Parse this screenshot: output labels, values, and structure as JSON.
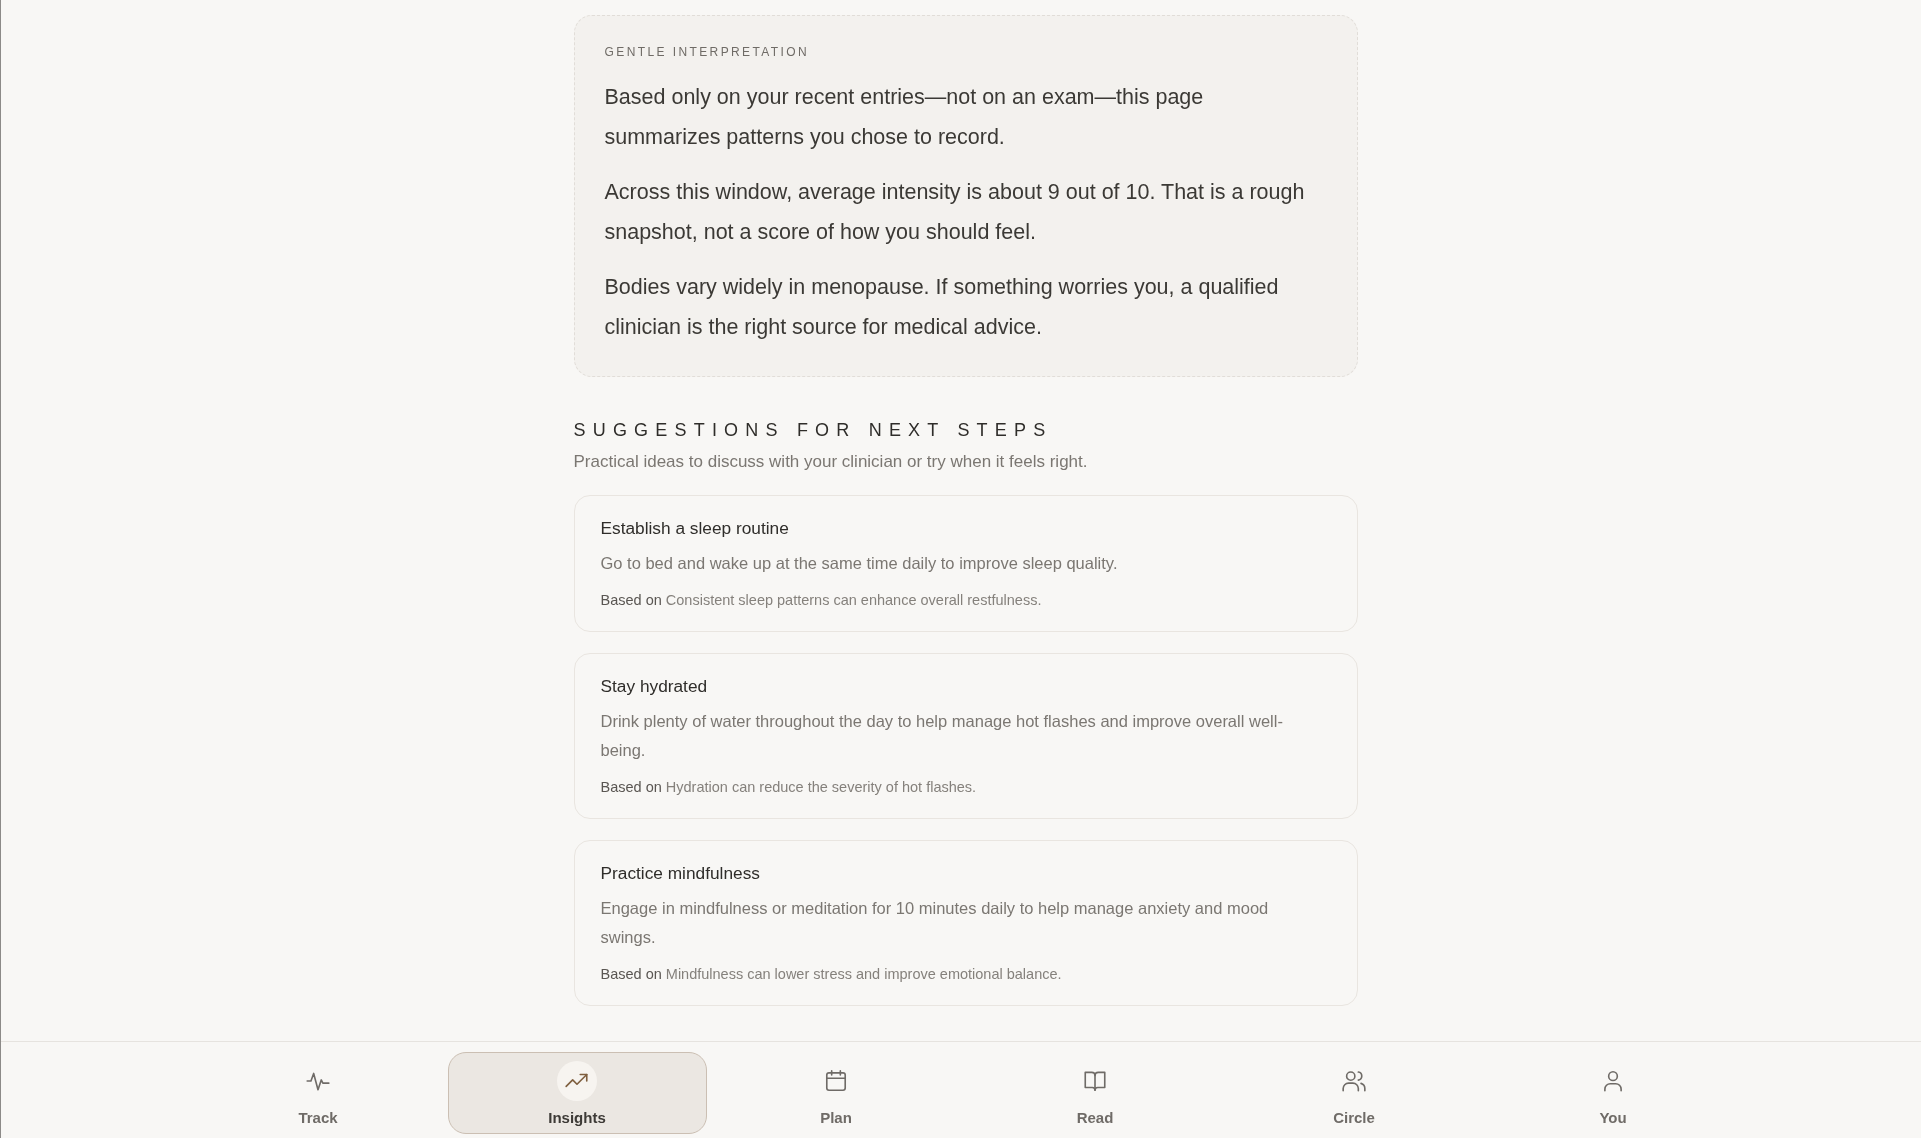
{
  "interpretation": {
    "label": "GENTLE INTERPRETATION",
    "paragraphs": [
      "Based only on your recent entries—not on an exam—this page summarizes patterns you chose to record.",
      "Across this window, average intensity is about 9 out of 10. That is a rough snapshot, not a score of how you should feel.",
      "Bodies vary widely in menopause. If something worries you, a qualified clinician is the right source for medical advice."
    ]
  },
  "suggestions": {
    "title": "SUGGESTIONS FOR NEXT STEPS",
    "subtitle": "Practical ideas to discuss with your clinician or try when it feels right.",
    "items": [
      {
        "title": "Establish a sleep routine",
        "description": "Go to bed and wake up at the same time daily to improve sleep quality.",
        "basis_label": "Based on",
        "basis": "Consistent sleep patterns can enhance overall restfulness."
      },
      {
        "title": "Stay hydrated",
        "description": "Drink plenty of water throughout the day to help manage hot flashes and improve overall well-being.",
        "basis_label": "Based on",
        "basis": "Hydration can reduce the severity of hot flashes."
      },
      {
        "title": "Practice mindfulness",
        "description": "Engage in mindfulness or meditation for 10 minutes daily to help manage anxiety and mood swings.",
        "basis_label": "Based on",
        "basis": "Mindfulness can lower stress and improve emotional balance."
      }
    ]
  },
  "bottom_nav": {
    "items": [
      {
        "label": "Track",
        "selected": false
      },
      {
        "label": "Insights",
        "selected": true
      },
      {
        "label": "Plan",
        "selected": false
      },
      {
        "label": "Read",
        "selected": false
      },
      {
        "label": "Circle",
        "selected": false
      },
      {
        "label": "You",
        "selected": false
      }
    ]
  }
}
